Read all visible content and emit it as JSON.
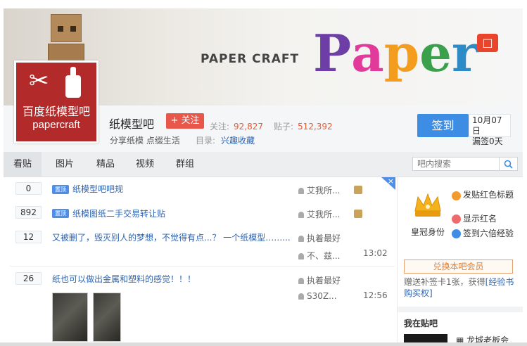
{
  "banner": {
    "title": "PAPER  CRAFT",
    "letters": [
      "P",
      "a",
      "p",
      "e",
      "r"
    ]
  },
  "logo": {
    "cn_text": "百度纸模型吧",
    "en_text": "papercraft"
  },
  "forum": {
    "name": "纸模型吧",
    "follow_label": "+ 关注",
    "followers_label": "关注:",
    "followers_count": "92,827",
    "posts_label": "贴子:",
    "posts_count": "512,392",
    "slogan": "分享纸模 点缀生活",
    "catalog_label": "目录:",
    "catalog_value": "兴趣收藏"
  },
  "sign_in": {
    "label": "签到",
    "date": "10月07日",
    "missed": "漏签0天"
  },
  "nav": {
    "tabs": [
      "看贴",
      "图片",
      "精品",
      "视频",
      "群组"
    ],
    "search_placeholder": "吧内搜索"
  },
  "threads": [
    {
      "replies": "0",
      "badge": "置顶",
      "title": "纸模型吧吧规",
      "author": "艾我所...",
      "last_user": "",
      "time": ""
    },
    {
      "replies": "892",
      "badge": "置顶",
      "title": "纸模图纸二手交易转让贴",
      "author": "艾我所...",
      "last_user": "",
      "time": ""
    },
    {
      "replies": "12",
      "badge": "",
      "title": "又被删了，毁灭别人的梦想，不觉得有点...？ 一个纸模型……...",
      "author": "执着最好",
      "last_user": "不、兹...",
      "time": "13:02"
    },
    {
      "replies": "26",
      "badge": "",
      "title": "纸也可以做出金属和塑料的感觉！！！",
      "author": "执着最好",
      "last_user": "S30Z...",
      "time": "12:56"
    }
  ],
  "sidebar": {
    "crown_label": "皇冠身份",
    "privileges": [
      "发贴红色标题",
      "显示红名",
      "签到六倍经验"
    ],
    "vip_button": "兑换本吧会员",
    "exp_note_prefix": "赠送补签卡1张，获得",
    "exp_note_link": "[经验书购买权]",
    "my_forums_title": "我在贴吧",
    "forum_link": "龙城老板会"
  },
  "colors": {
    "accent_blue": "#3e8de4",
    "follow_red": "#e8574a",
    "link_blue": "#2d64b3",
    "count_orange": "#e25c35",
    "logo_red": "#b32a2a"
  }
}
